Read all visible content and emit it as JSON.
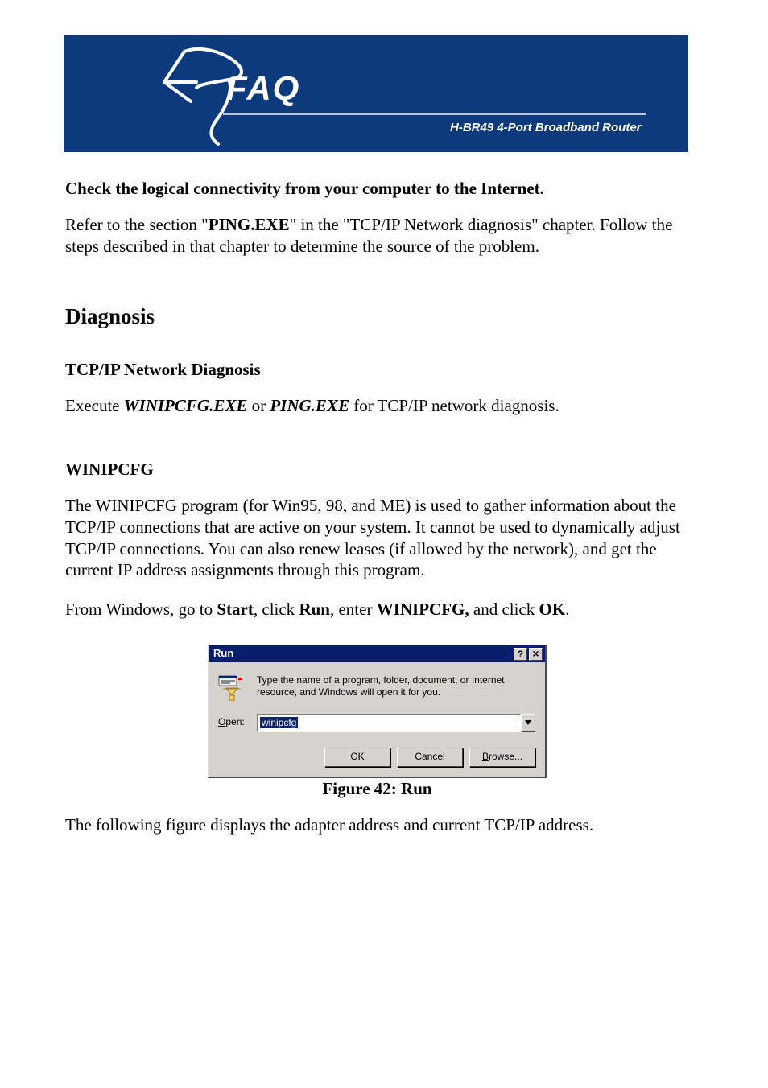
{
  "banner": {
    "faq": "FAQ",
    "product": "H-BR49 4-Port Broadband Router"
  },
  "doc": {
    "subhead1": "Check the logical connectivity from your computer to the Internet.",
    "p1_a": "Refer to the section \"",
    "p1_bold": "PING.EXE",
    "p1_b": "\" in the \"TCP/IP Network diagnosis\" chapter. Follow the steps described in that chapter to determine the source of the problem.",
    "h2_diag": "Diagnosis",
    "h3_tcpip": "TCP/IP Network Diagnosis",
    "p2_a": "Execute ",
    "p2_i1": "WINIPCFG.EXE",
    "p2_b": " or ",
    "p2_i2": "PING.EXE",
    "p2_c": " for TCP/IP network diagnosis.",
    "h3_winip": "WINIPCFG",
    "p3": "The WINIPCFG program (for Win95, 98, and ME) is used to gather information about the TCP/IP connections that are active on your system. It cannot be used to dynamically adjust TCP/IP connections. You can also renew leases (if allowed by the network), and get the current IP address assignments through this program.",
    "p4_a": "From Windows, go to ",
    "p4_b1": "Start",
    "p4_b": ", click ",
    "p4_b2": "Run",
    "p4_c": ", enter ",
    "p4_b3": "WINIPCFG,",
    "p4_d": " and click ",
    "p4_b4": "OK",
    "p4_e": ".",
    "caption": "Figure 42: Run",
    "closing": "The following figure displays the adapter address and current TCP/IP address."
  },
  "dialog": {
    "title": "Run",
    "help_glyph": "?",
    "close_glyph": "×",
    "desc": "Type the name of a program, folder, document, or Internet resource, and Windows will open it for you.",
    "open_label_u": "O",
    "open_label_rest": "pen:",
    "open_value": "winipcfg",
    "ok": "OK",
    "cancel": "Cancel",
    "browse_u": "B",
    "browse_rest": "rowse..."
  }
}
